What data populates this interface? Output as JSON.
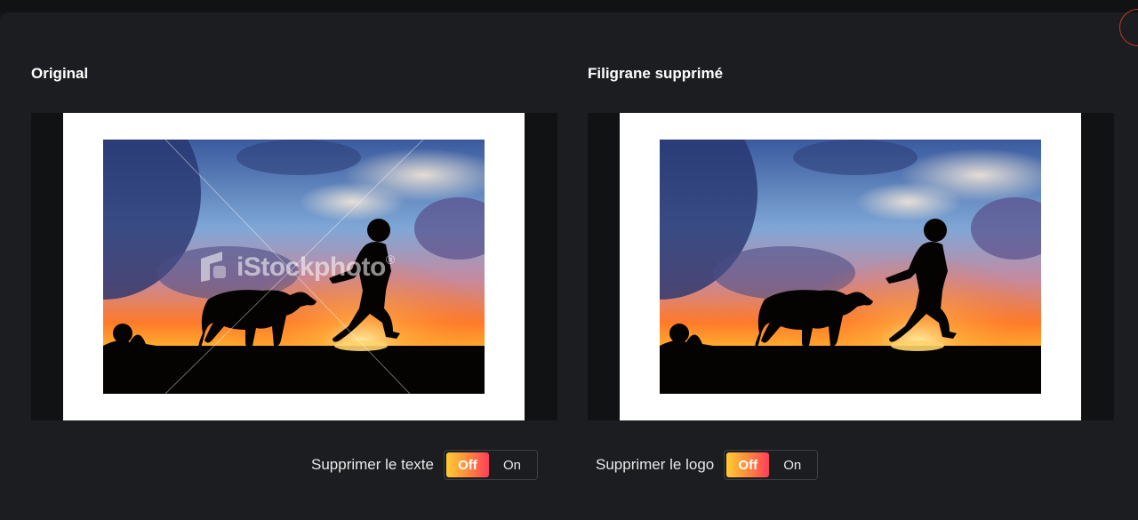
{
  "left_panel": {
    "title": "Original",
    "image": {
      "watermark_text": "iStockphoto",
      "watermark_symbol": "®",
      "description": "silhouette-boy-and-dog-running-at-sunset"
    }
  },
  "right_panel": {
    "title": "Filigrane supprimé",
    "image": {
      "description": "silhouette-boy-and-dog-running-at-sunset"
    }
  },
  "controls": {
    "remove_text": {
      "label": "Supprimer le texte",
      "off_label": "Off",
      "on_label": "On",
      "state": "off"
    },
    "remove_logo": {
      "label": "Supprimer le logo",
      "off_label": "Off",
      "on_label": "On",
      "state": "off"
    }
  },
  "colors": {
    "background": "#1c1d20",
    "viewer_bg": "#111214",
    "toggle_gradient_start": "#ffcc33",
    "toggle_gradient_end": "#ff3d5a",
    "close_ring": "#c0392b"
  },
  "icons": {
    "close": "close-icon"
  }
}
